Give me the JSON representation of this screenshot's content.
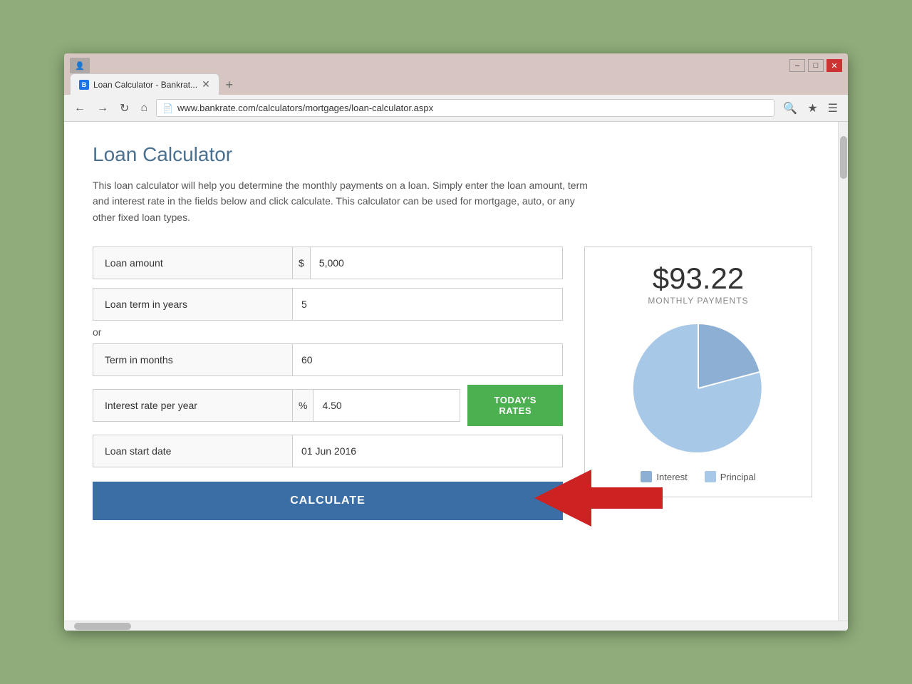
{
  "browser": {
    "title": "Loan Calculator - Bankrate",
    "url": "www.bankrate.com/calculators/mortgages/loan-calculator.aspx",
    "tab_label": "Loan Calculator - Bankrat...",
    "favicon_letter": "B"
  },
  "page": {
    "title": "Loan Calculator",
    "description": "This loan calculator will help you determine the monthly payments on a loan. Simply enter the loan amount, term and interest rate in the fields below and click calculate. This calculator can be used for mortgage, auto, or any other fixed loan types."
  },
  "form": {
    "loan_amount_label": "Loan amount",
    "loan_amount_symbol": "$",
    "loan_amount_value": "5,000",
    "loan_term_years_label": "Loan term in years",
    "loan_term_years_value": "5",
    "or_text": "or",
    "term_months_label": "Term in months",
    "term_months_value": "60",
    "interest_rate_label": "Interest rate per year",
    "interest_rate_symbol": "%",
    "interest_rate_value": "4.50",
    "todays_rates_label": "TODAY'S RATES",
    "loan_start_label": "Loan start date",
    "loan_start_value": "01 Jun 2016",
    "calculate_label": "CALCULATE"
  },
  "results": {
    "monthly_amount": "$93.22",
    "monthly_label": "MONTHLY PAYMENTS",
    "interest_label": "Interest",
    "principal_label": "Principal",
    "interest_color": "#8dafd4",
    "principal_color": "#a8c8e8",
    "interest_pct": 18,
    "principal_pct": 82
  }
}
